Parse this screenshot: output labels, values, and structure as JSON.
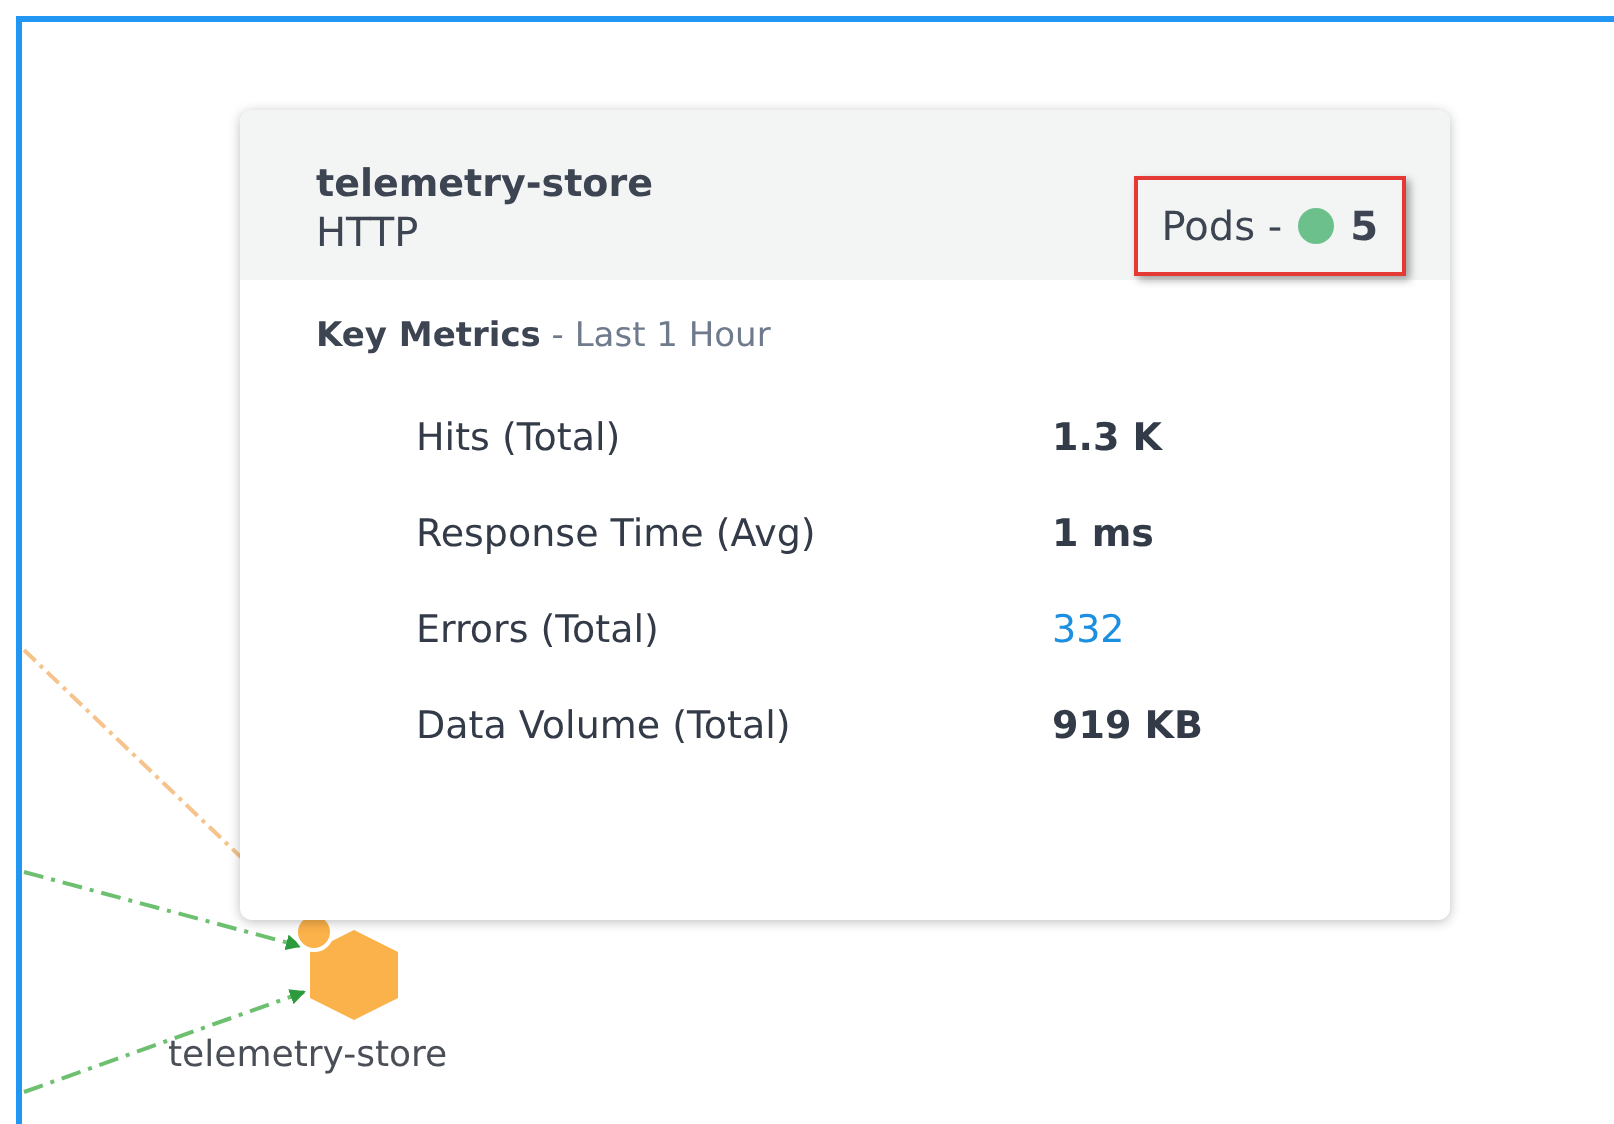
{
  "card": {
    "title": "telemetry-store",
    "subtitle": "HTTP",
    "pods": {
      "label": "Pods -",
      "count": "5",
      "color": "#6cc08b",
      "highlighted": true
    },
    "section": {
      "title": "Key Metrics",
      "period": "- Last 1 Hour"
    },
    "metrics": [
      {
        "label": "Hits (Total)",
        "value": "1.3 K",
        "kind": "plain"
      },
      {
        "label": "Response Time (Avg)",
        "value": "1 ms",
        "kind": "plain"
      },
      {
        "label": "Errors (Total)",
        "value": "332",
        "kind": "link"
      },
      {
        "label": "Data Volume (Total)",
        "value": "919 KB",
        "kind": "plain"
      }
    ]
  },
  "node": {
    "label": "telemetry-store"
  }
}
